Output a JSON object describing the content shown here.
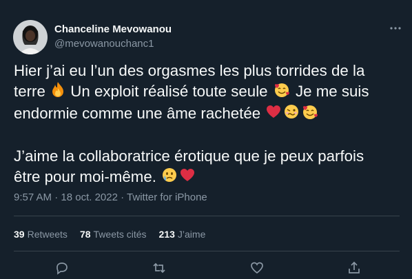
{
  "author": {
    "display_name": "Chanceline Mevowanou",
    "handle": "@mevowanouchanc1"
  },
  "tweet": {
    "line1": "Hier j’ai eu l’un des orgasmes les plus torrides de la",
    "line2_a": "terre ",
    "line2_b": " Un exploit réalisé toute seule ",
    "line2_c": " Je me suis",
    "line3_a": "endormie comme une âme rachetée ",
    "line5": "J’aime la collaboratrice érotique que je peux parfois",
    "line6_a": "être pour moi-même. "
  },
  "meta": {
    "time": "9:57 AM",
    "sep1": " · ",
    "date": "18 oct. 2022",
    "sep2": " · ",
    "source": "Twitter for iPhone"
  },
  "stats": {
    "retweets_count": "39",
    "retweets_label": "Retweets",
    "quotes_count": "78",
    "quotes_label": "Tweets cités",
    "likes_count": "213",
    "likes_label": "J’aime"
  },
  "icons": {
    "fire": "fire-emoji",
    "smiling_hearts": "smiling-face-with-hearts-emoji",
    "heart": "red-heart-emoji",
    "woozy": "woozy-face-emoji",
    "tear": "face-holding-back-tears-emoji"
  },
  "colors": {
    "background": "#15202b",
    "text": "#f7f9f9",
    "secondary": "#8b98a5",
    "divider": "#38444d"
  }
}
